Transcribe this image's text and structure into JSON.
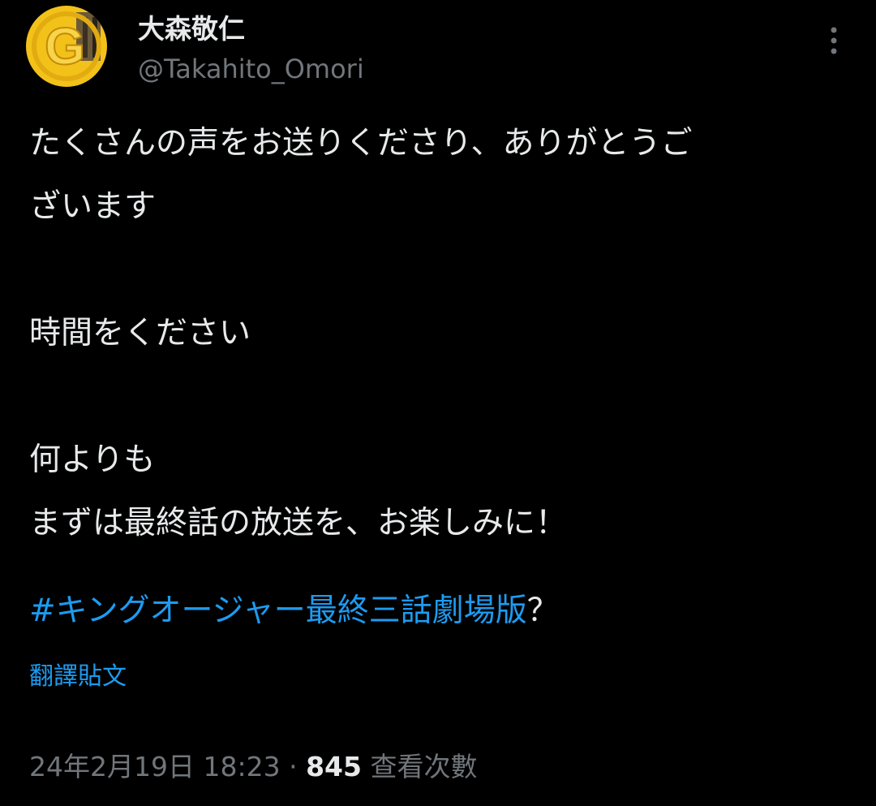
{
  "author": {
    "display_name": "大森敬仁",
    "handle": "@Takahito_Omori",
    "avatar_letter": "G"
  },
  "menu": {
    "icon": "more-vertical-icon"
  },
  "tweet": {
    "lines": [
      "たくさんの声をお送りくださり、ありがとうご",
      "ざいます",
      "",
      "時間をください",
      "",
      "何よりも",
      "まずは最終話の放送を、お楽しみに！"
    ],
    "hashtag": "#キングオージャー最終三話劇場版",
    "hashtag_suffix": "？",
    "translate_label": "翻譯貼文"
  },
  "meta": {
    "timestamp": "24年2月19日 18:23",
    "separator": "·",
    "views_count": "845",
    "views_label": "查看次數"
  },
  "colors": {
    "background": "#000000",
    "text_primary": "#e7e9ea",
    "text_secondary": "#71767b",
    "link": "#1d9bf0",
    "avatar_gold": "#f2c21a"
  }
}
